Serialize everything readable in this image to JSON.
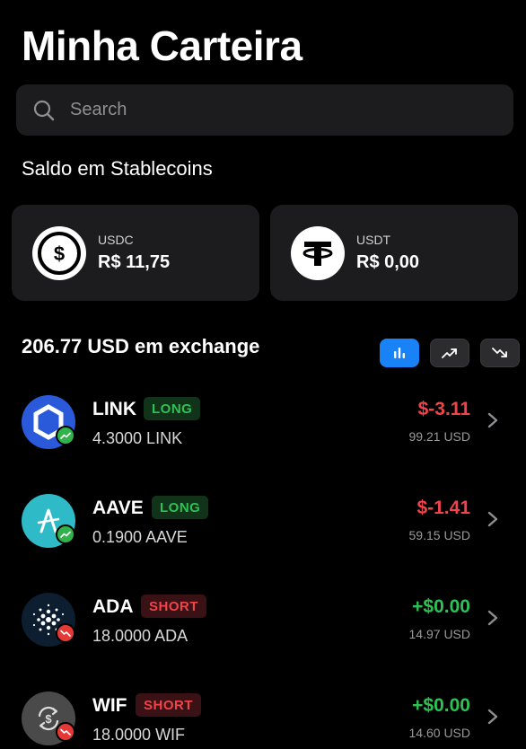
{
  "title": "Minha Carteira",
  "search": {
    "placeholder": "Search"
  },
  "stablecoins": {
    "heading": "Saldo em Stablecoins",
    "items": [
      {
        "symbol": "USDC",
        "value": "R$ 11,75",
        "icon": "usdc-icon"
      },
      {
        "symbol": "USDT",
        "value": "R$ 0,00",
        "icon": "usdt-icon"
      }
    ]
  },
  "exchange": {
    "heading": "206.77 USD em exchange",
    "view_buttons": [
      {
        "icon": "bar-chart-icon",
        "active": true
      },
      {
        "icon": "trend-up-icon",
        "active": false
      },
      {
        "icon": "trend-down-icon",
        "active": false
      }
    ]
  },
  "positions": [
    {
      "name": "LINK",
      "tag": "LONG",
      "qty": "4.3000 LINK",
      "pnl": "$-3.11",
      "usd": "99.21 USD",
      "direction": "up",
      "color": "#2a5ada",
      "icon": "chainlink-icon"
    },
    {
      "name": "AAVE",
      "tag": "LONG",
      "qty": "0.1900 AAVE",
      "pnl": "$-1.41",
      "usd": "59.15 USD",
      "direction": "up",
      "color": "#2ebac6",
      "icon": "aave-icon"
    },
    {
      "name": "ADA",
      "tag": "SHORT",
      "qty": "18.0000 ADA",
      "pnl": "+$0.00",
      "usd": "14.97 USD",
      "direction": "down",
      "color": "#0d1e30",
      "icon": "cardano-icon"
    },
    {
      "name": "WIF",
      "tag": "SHORT",
      "qty": "18.0000 WIF",
      "pnl": "+$0.00",
      "usd": "14.60 USD",
      "direction": "down",
      "color": "#4a4a4a",
      "icon": "swap-dollar-icon"
    }
  ]
}
